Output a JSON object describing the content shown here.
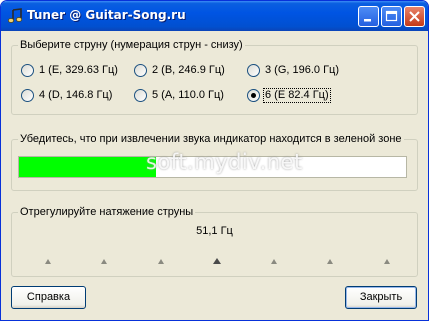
{
  "window": {
    "title": "Tuner @ Guitar-Song.ru"
  },
  "string_group": {
    "legend": "Выберите струну (нумерация струн - снизу)",
    "options": [
      {
        "label": "1 (E, 329.63 Гц)",
        "selected": false
      },
      {
        "label": "2 (B, 246.9 Гц)",
        "selected": false
      },
      {
        "label": "3 (G, 196.0 Гц)",
        "selected": false
      },
      {
        "label": "4 (D, 146.8 Гц)",
        "selected": false
      },
      {
        "label": "5 (A, 110.0 Гц)",
        "selected": false
      },
      {
        "label": "6 (E 82.4 Гц)",
        "selected": true
      }
    ]
  },
  "meter_group": {
    "legend": "Убедитесь, что при извлечении звука индикатор находится в зеленой зоне",
    "level_fraction": 0.355,
    "fill_color": "#00ff00"
  },
  "tension_group": {
    "legend": "Отрегулируйте натяжение струны",
    "frequency": "51,1 Гц",
    "tick_count": 7,
    "active_tick": 3
  },
  "buttons": {
    "help": "Справка",
    "close": "Закрыть"
  },
  "watermark": "soft.mydiv.net"
}
